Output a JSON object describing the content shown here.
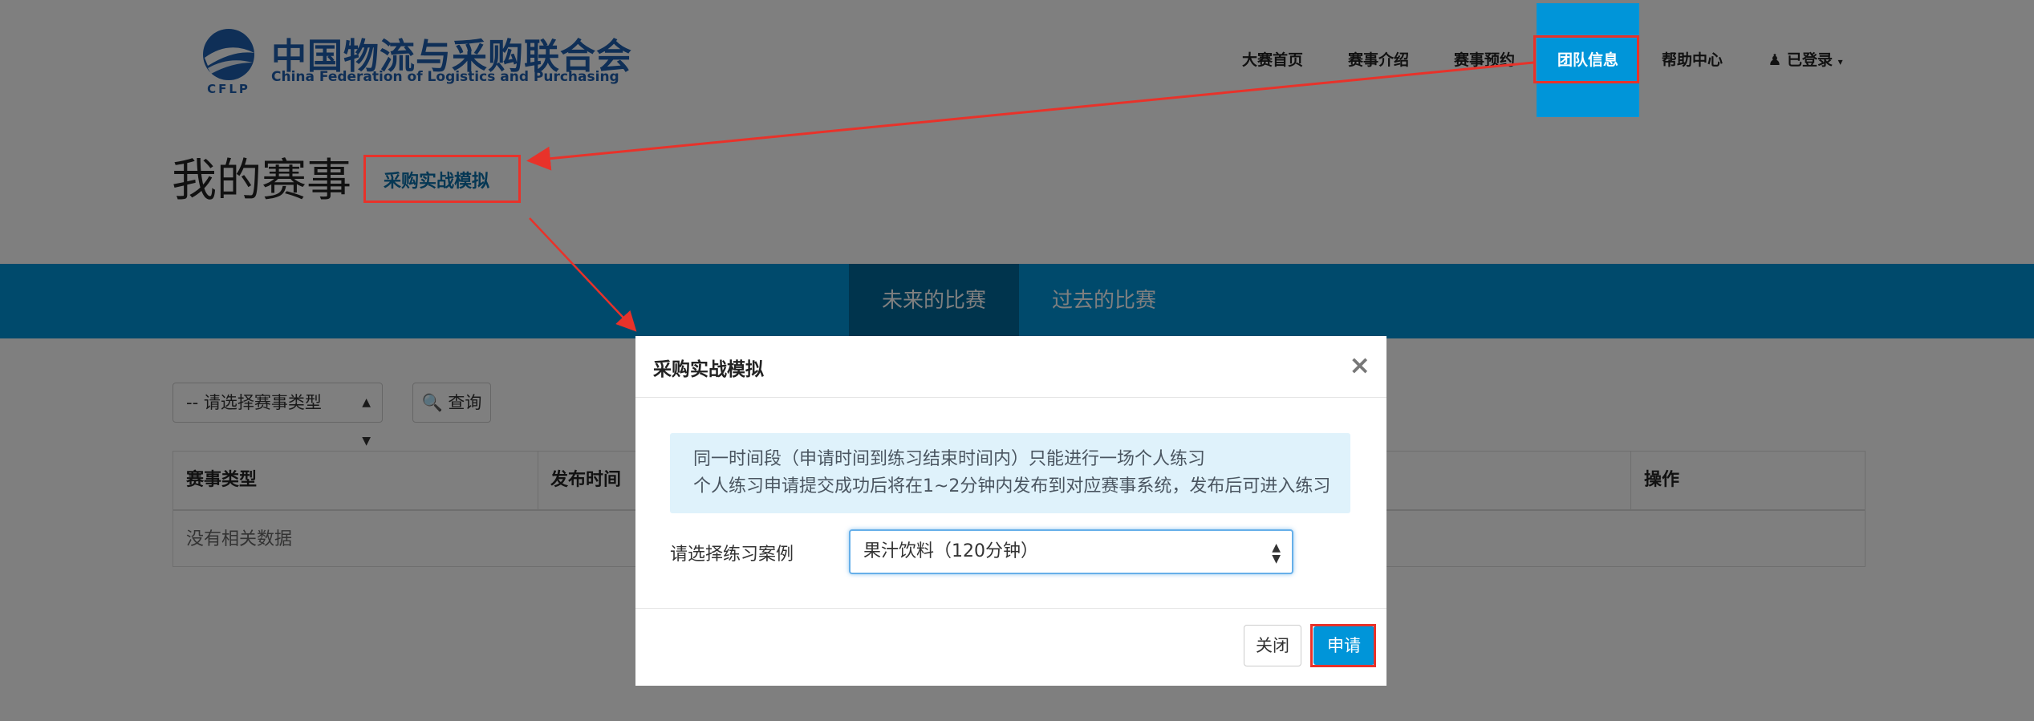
{
  "logo": {
    "name_cn": "中国物流与采购联合会",
    "name_en": "China Federation of Logistics and Purchasing",
    "mark_text": "CFLP"
  },
  "nav": {
    "items": [
      {
        "label": "大赛首页"
      },
      {
        "label": "赛事介绍"
      },
      {
        "label": "赛事预约"
      },
      {
        "label": "团队信息",
        "active": true
      },
      {
        "label": "帮助中心"
      },
      {
        "label": "已登录",
        "icon": "user-icon",
        "dropdown": true
      }
    ]
  },
  "page": {
    "title": "我的赛事",
    "badge": "采购实战模拟"
  },
  "tabs": [
    {
      "label": "未来的比赛",
      "active": true
    },
    {
      "label": "过去的比赛"
    }
  ],
  "filter": {
    "select_value": "-- 请选择赛事类型",
    "query_label": "查询"
  },
  "table": {
    "headers": [
      "赛事类型",
      "发布时间",
      "操作"
    ],
    "empty_text": "没有相关数据"
  },
  "modal": {
    "title": "采购实战模拟",
    "close_symbol": "×",
    "notice_lines": [
      "同一时间段（申请时间到练习结束时间内）只能进行一场个人练习",
      "个人练习申请提交成功后将在1~2分钟内发布到对应赛事系统，发布后可进入练习"
    ],
    "case_label": "请选择练习案例",
    "case_value": "果汁饮料（120分钟）",
    "btn_close": "关闭",
    "btn_apply": "申请"
  },
  "colors": {
    "accent": "#0095d9",
    "accent_dark": "#00699a",
    "annotation": "#e8322a",
    "notice_bg": "#dff2fb"
  }
}
